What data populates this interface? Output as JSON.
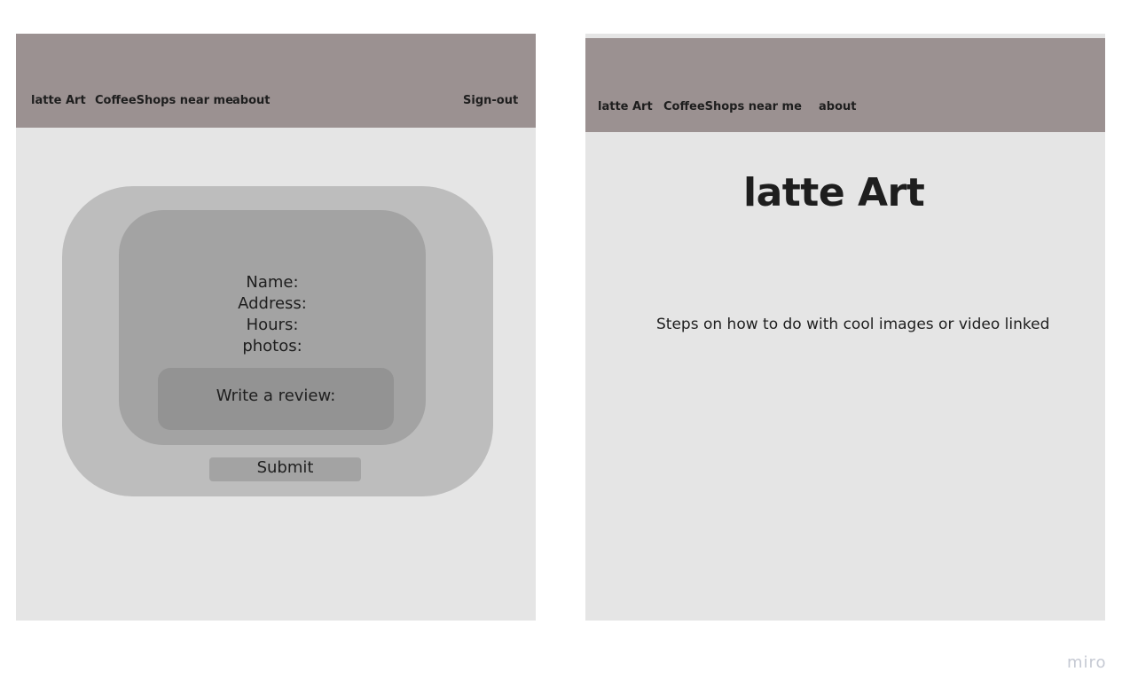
{
  "left_frame": {
    "nav": {
      "latte_art": "latte Art",
      "coffeeshops": "CoffeeShops near me",
      "about": "about",
      "sign_out": "Sign-out"
    },
    "card": {
      "name_label": "Name:",
      "address_label": "Address:",
      "hours_label": "Hours:",
      "photos_label": "photos:",
      "review_label": "Write a review:",
      "submit_label": "Submit"
    }
  },
  "right_frame": {
    "nav": {
      "latte_art": "latte Art",
      "coffeeshops": "CoffeeShops near me",
      "about": "about"
    },
    "heading": "latte Art",
    "steps_text": "Steps on how to do with cool images or video linked"
  },
  "watermark": "miro",
  "colors": {
    "navbar": "#9b9191",
    "frame_background": "#e5e5e5",
    "outer_card": "#bdbdbd",
    "inner_card": "#a3a3a3",
    "review_box": "#939393"
  }
}
